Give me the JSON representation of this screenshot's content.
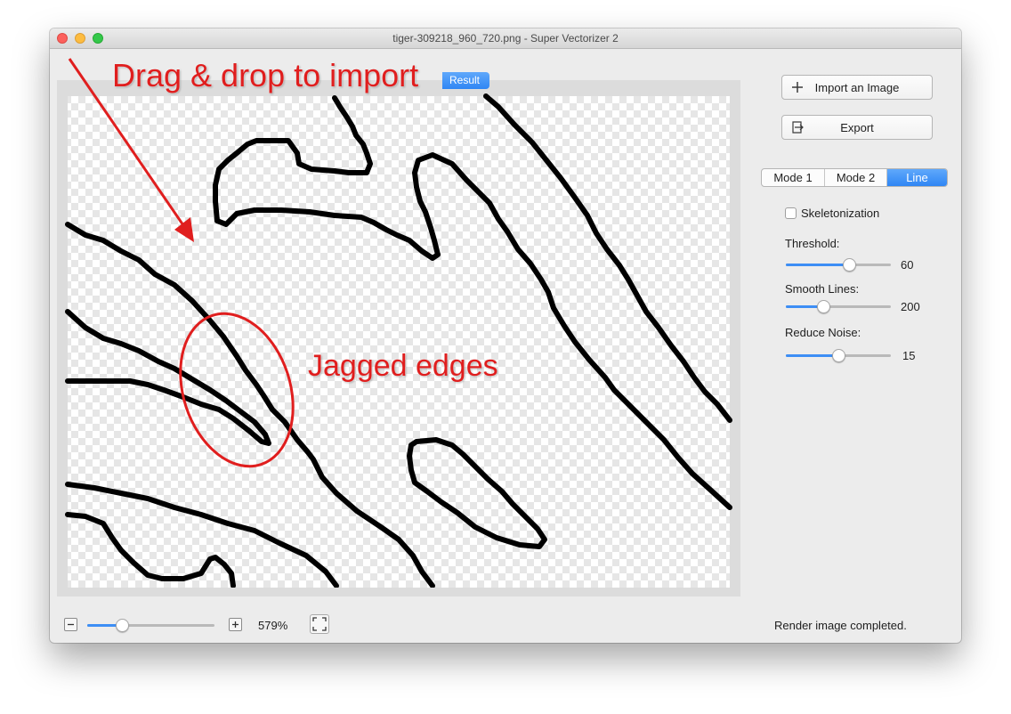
{
  "window": {
    "title": "tiger-309218_960_720.png - Super Vectorizer 2"
  },
  "canvas": {
    "result_tab_label": "Result",
    "line_color": "#000000",
    "checker_colors": [
      "#ffffff",
      "#e6e6e6"
    ]
  },
  "annotations": {
    "drag_drop": "Drag & drop to import",
    "jagged": "Jagged edges",
    "color": "#e01e1e"
  },
  "sidebar": {
    "import_label": "Import an Image",
    "export_label": "Export",
    "modes": [
      "Mode 1",
      "Mode 2",
      "Line"
    ],
    "selected_mode": "Line",
    "skeletonization_label": "Skeletonization",
    "skeletonization_checked": false,
    "threshold": {
      "label": "Threshold:",
      "value": "60",
      "level": 0.6
    },
    "smooth_lines": {
      "label": "Smooth Lines:",
      "value": "200",
      "level": 0.36
    },
    "reduce_noise": {
      "label": "Reduce Noise:",
      "value": "15",
      "level": 0.5
    }
  },
  "footer": {
    "zoom_value": "579%",
    "zoom_level": 0.27,
    "status": "Render image completed."
  },
  "colors": {
    "accent": "#3d8ef5",
    "window_bg": "#ececec"
  }
}
